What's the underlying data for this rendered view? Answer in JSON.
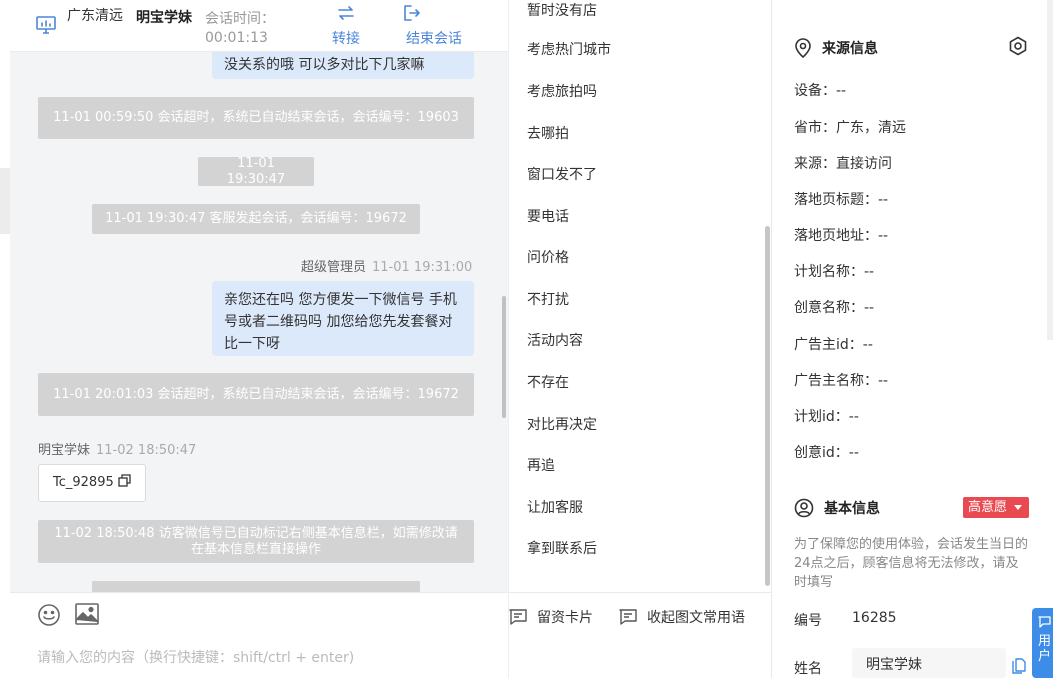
{
  "header": {
    "location": "广东清远",
    "user": "明宝学妹",
    "time_label": "会话时间：",
    "time_value": "00:01:13",
    "transfer_label": "转接",
    "end_label": "结束会话"
  },
  "chat": {
    "msg_top_partial": "没关系的哦 可以多对比下几家嘛",
    "sys1": "11-01 00:59:50 会话超时，系统已自动结束会话，会话编号：19603",
    "time1": "11-01 19:30:47",
    "sys2": "11-01 19:30:47 客服发起会话，会话编号：19672",
    "agent_name": "超级管理员",
    "agent_time": "11-01 19:31:00",
    "agent_msg": "亲您还在吗 您方便发一下微信号 手机号或者二维码吗 加您给您先发套餐对比一下呀",
    "sys3": "11-01 20:01:03 会话超时，系统已自动结束会话，会话编号：19672",
    "visitor_name": "明宝学妹",
    "visitor_time": "11-02 18:50:47",
    "visitor_card": "Tc_92895",
    "sys4": "11-02 18:50:48 访客微信号已自动标记右侧基本信息栏，如需修改请在基本信息栏直接操作"
  },
  "composer": {
    "placeholder": "请输入您的内容（换行快捷键：shift/ctrl + enter)"
  },
  "phrases": {
    "items": [
      "暂时没有店",
      "考虑热门城市",
      "考虑旅拍吗",
      "去哪拍",
      "窗口发不了",
      "要电话",
      "问价格",
      "不打扰",
      "活动内容",
      "不存在",
      "对比再决定",
      "再追",
      "让加客服",
      "拿到联系后"
    ],
    "card_btn": "留资卡片",
    "collapse_btn": "收起图文常用语"
  },
  "info": {
    "source_title": "来源信息",
    "source_rows": [
      "设备：--",
      "省市：广东，清远",
      "来源：直接访问",
      "落地页标题：--",
      "落地页地址：--",
      "计划名称：--",
      "创意名称：--",
      "广告主id：--",
      "广告主名称：--",
      "计划id：--",
      "创意id：--"
    ],
    "basic_title": "基本信息",
    "intent_badge": "高意愿",
    "notice": "为了保障您的使用体验，会话发生当日的24点之后，顾客信息将无法修改，请及时填写",
    "id_label": "编号",
    "id_value": "16285",
    "name_label": "姓名",
    "name_value": "明宝学妹",
    "float_tab": "用户"
  },
  "colors": {
    "accent": "#4a86d9",
    "agent_bubble": "#dce9fb",
    "system_notice": "#d3d3d3",
    "badge": "#e94a52"
  }
}
